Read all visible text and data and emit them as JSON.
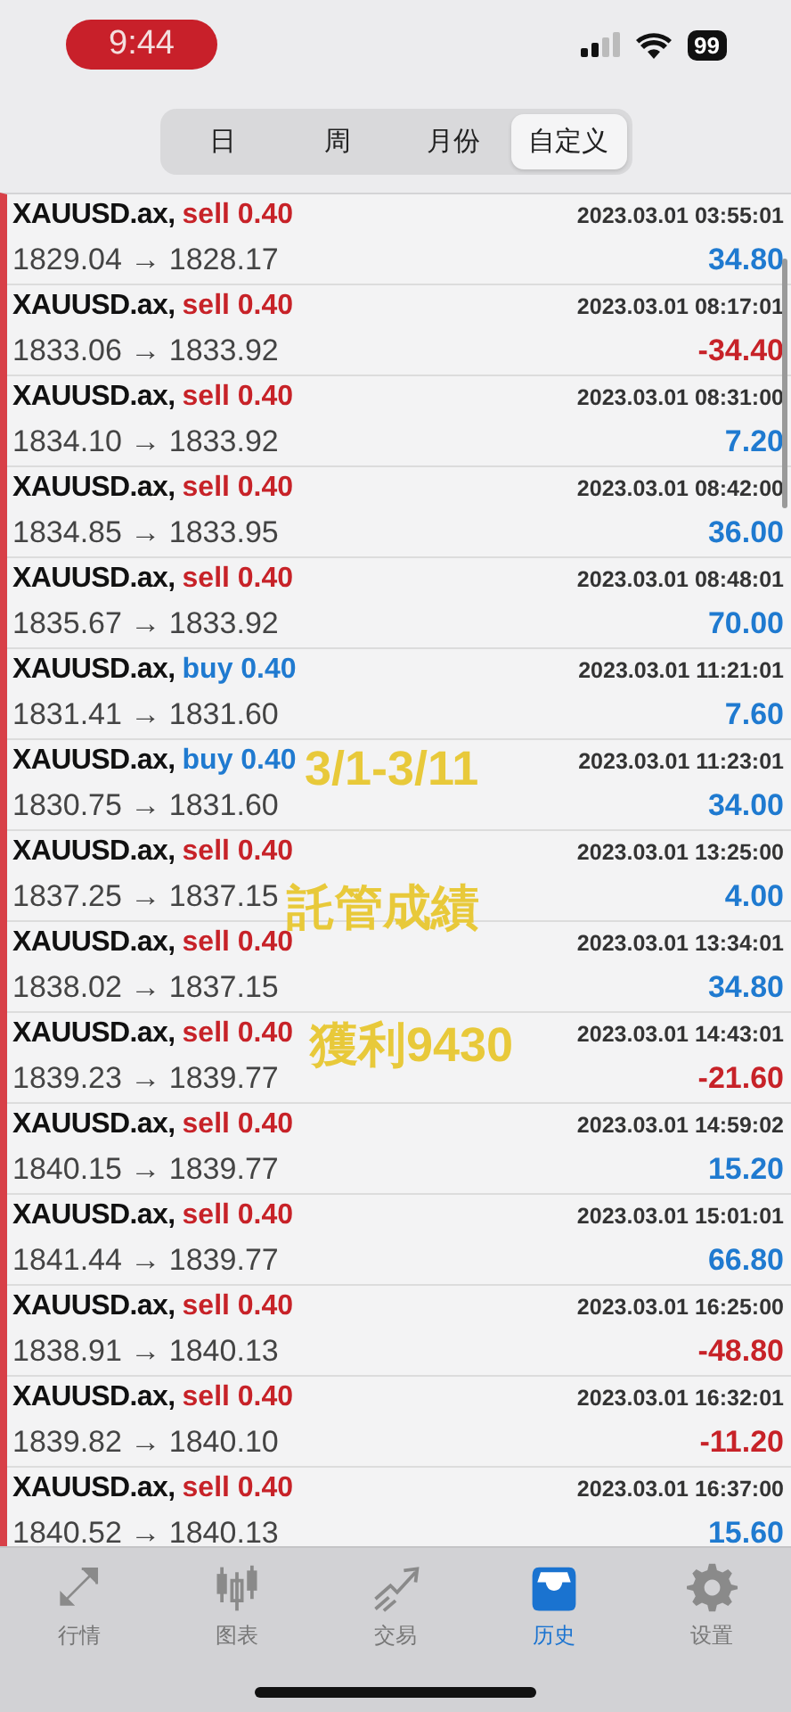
{
  "status_bar": {
    "time": "9:44",
    "battery": "99"
  },
  "period_tabs": [
    {
      "label": "日",
      "selected": false
    },
    {
      "label": "周",
      "selected": false
    },
    {
      "label": "月份",
      "selected": false
    },
    {
      "label": "自定义",
      "selected": true
    }
  ],
  "trades": [
    {
      "symbol": "XAUUSD.ax,",
      "type": {
        "text": "sell 0.40",
        "color": "#c72228"
      },
      "prices": "1829.04 → 1828.17",
      "time": "2023.03.01 03:55:01",
      "profit": {
        "text": "34.80",
        "color": "#1f7ad0"
      }
    },
    {
      "symbol": "XAUUSD.ax,",
      "type": {
        "text": "sell 0.40",
        "color": "#c72228"
      },
      "prices": "1833.06 → 1833.92",
      "time": "2023.03.01 08:17:01",
      "profit": {
        "text": "-34.40",
        "color": "#c72228"
      }
    },
    {
      "symbol": "XAUUSD.ax,",
      "type": {
        "text": "sell 0.40",
        "color": "#c72228"
      },
      "prices": "1834.10 → 1833.92",
      "time": "2023.03.01 08:31:00",
      "profit": {
        "text": "7.20",
        "color": "#1f7ad0"
      }
    },
    {
      "symbol": "XAUUSD.ax,",
      "type": {
        "text": "sell 0.40",
        "color": "#c72228"
      },
      "prices": "1834.85 → 1833.95",
      "time": "2023.03.01 08:42:00",
      "profit": {
        "text": "36.00",
        "color": "#1f7ad0"
      }
    },
    {
      "symbol": "XAUUSD.ax,",
      "type": {
        "text": "sell 0.40",
        "color": "#c72228"
      },
      "prices": "1835.67 → 1833.92",
      "time": "2023.03.01 08:48:01",
      "profit": {
        "text": "70.00",
        "color": "#1f7ad0"
      }
    },
    {
      "symbol": "XAUUSD.ax,",
      "type": {
        "text": "buy 0.40",
        "color": "#1f7ad0"
      },
      "prices": "1831.41 → 1831.60",
      "time": "2023.03.01 11:21:01",
      "profit": {
        "text": "7.60",
        "color": "#1f7ad0"
      }
    },
    {
      "symbol": "XAUUSD.ax,",
      "type": {
        "text": "buy 0.40",
        "color": "#1f7ad0"
      },
      "prices": "1830.75 → 1831.60",
      "time": "2023.03.01 11:23:01",
      "profit": {
        "text": "34.00",
        "color": "#1f7ad0"
      }
    },
    {
      "symbol": "XAUUSD.ax,",
      "type": {
        "text": "sell 0.40",
        "color": "#c72228"
      },
      "prices": "1837.25 → 1837.15",
      "time": "2023.03.01 13:25:00",
      "profit": {
        "text": "4.00",
        "color": "#1f7ad0"
      }
    },
    {
      "symbol": "XAUUSD.ax,",
      "type": {
        "text": "sell 0.40",
        "color": "#c72228"
      },
      "prices": "1838.02 → 1837.15",
      "time": "2023.03.01 13:34:01",
      "profit": {
        "text": "34.80",
        "color": "#1f7ad0"
      }
    },
    {
      "symbol": "XAUUSD.ax,",
      "type": {
        "text": "sell 0.40",
        "color": "#c72228"
      },
      "prices": "1839.23 → 1839.77",
      "time": "2023.03.01 14:43:01",
      "profit": {
        "text": "-21.60",
        "color": "#c72228"
      }
    },
    {
      "symbol": "XAUUSD.ax,",
      "type": {
        "text": "sell 0.40",
        "color": "#c72228"
      },
      "prices": "1840.15 → 1839.77",
      "time": "2023.03.01 14:59:02",
      "profit": {
        "text": "15.20",
        "color": "#1f7ad0"
      }
    },
    {
      "symbol": "XAUUSD.ax,",
      "type": {
        "text": "sell 0.40",
        "color": "#c72228"
      },
      "prices": "1841.44 → 1839.77",
      "time": "2023.03.01 15:01:01",
      "profit": {
        "text": "66.80",
        "color": "#1f7ad0"
      }
    },
    {
      "symbol": "XAUUSD.ax,",
      "type": {
        "text": "sell 0.40",
        "color": "#c72228"
      },
      "prices": "1838.91 → 1840.13",
      "time": "2023.03.01 16:25:00",
      "profit": {
        "text": "-48.80",
        "color": "#c72228"
      }
    },
    {
      "symbol": "XAUUSD.ax,",
      "type": {
        "text": "sell 0.40",
        "color": "#c72228"
      },
      "prices": "1839.82 → 1840.10",
      "time": "2023.03.01 16:32:01",
      "profit": {
        "text": "-11.20",
        "color": "#c72228"
      }
    },
    {
      "symbol": "XAUUSD.ax,",
      "type": {
        "text": "sell 0.40",
        "color": "#c72228"
      },
      "prices": "1840.52 → 1840.13",
      "time": "2023.03.01 16:37:00",
      "profit": {
        "text": "15.60",
        "color": "#1f7ad0"
      }
    }
  ],
  "overlay_captions": [
    "3/1-3/11",
    "託管成績",
    "獲利9430"
  ],
  "bottom_tabs": [
    {
      "label": "行情",
      "selected": false
    },
    {
      "label": "图表",
      "selected": false
    },
    {
      "label": "交易",
      "selected": false
    },
    {
      "label": "历史",
      "selected": true
    },
    {
      "label": "设置",
      "selected": false
    }
  ]
}
